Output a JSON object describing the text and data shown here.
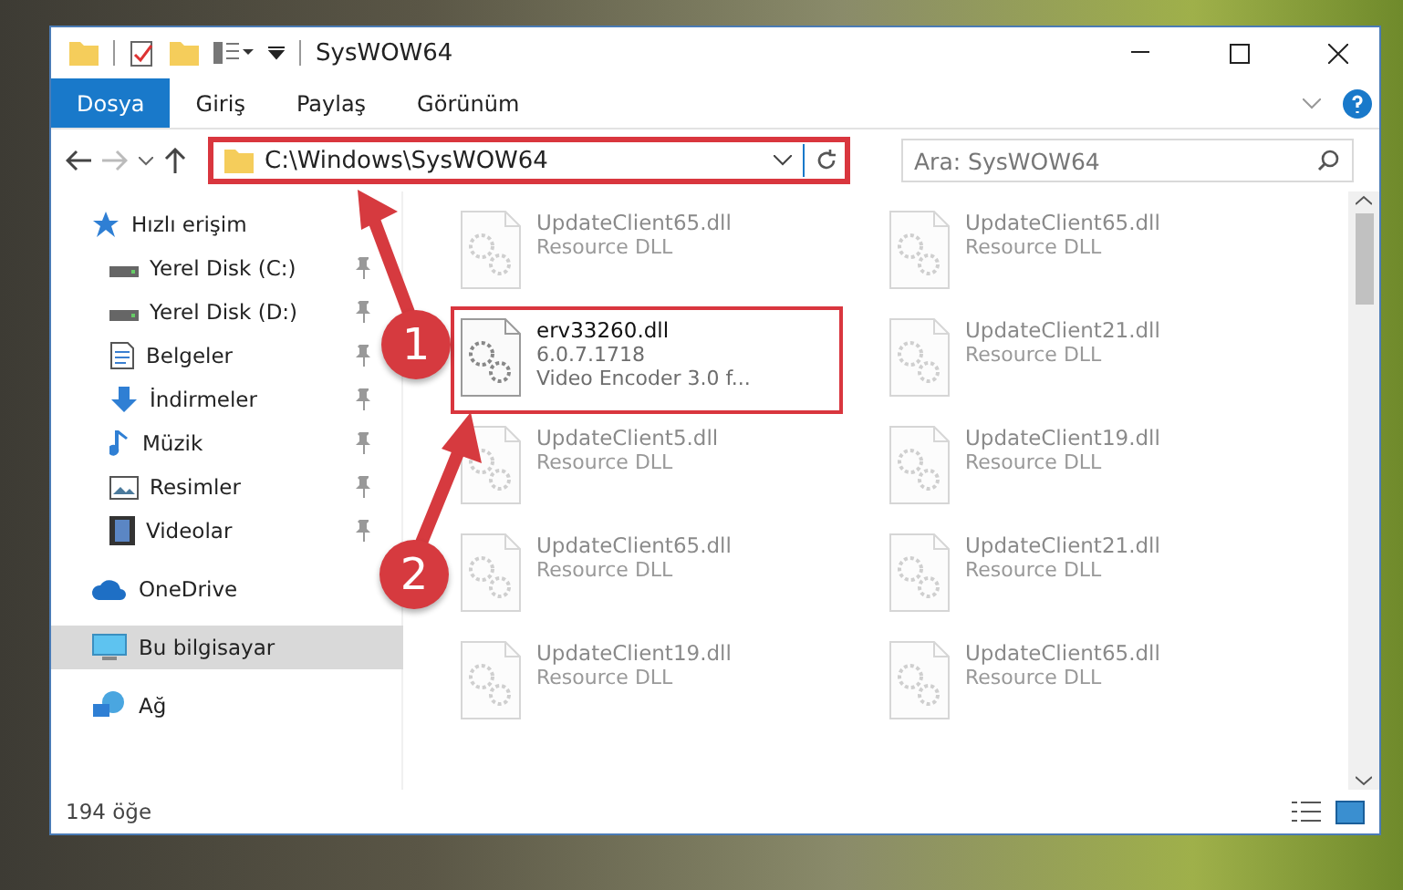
{
  "window": {
    "title": "SysWOW64"
  },
  "ribbon": {
    "tabs": [
      {
        "label": "Dosya",
        "selected": true
      },
      {
        "label": "Giriş",
        "selected": false
      },
      {
        "label": "Paylaş",
        "selected": false
      },
      {
        "label": "Görünüm",
        "selected": false
      }
    ]
  },
  "address": {
    "path": "C:\\Windows\\SysWOW64",
    "highlighted": true
  },
  "search": {
    "placeholder": "Ara: SysWOW64"
  },
  "sidebar": {
    "items": [
      {
        "label": "Hızlı erişim",
        "kind": "star",
        "selected": false,
        "children": [
          {
            "label": "Yerel Disk (C:)",
            "kind": "drive",
            "pinned": true
          },
          {
            "label": "Yerel Disk (D:)",
            "kind": "drive",
            "pinned": true
          },
          {
            "label": "Belgeler",
            "kind": "document",
            "pinned": true
          },
          {
            "label": "İndirmeler",
            "kind": "download",
            "pinned": true
          },
          {
            "label": "Müzik",
            "kind": "music",
            "pinned": true
          },
          {
            "label": "Resimler",
            "kind": "picture",
            "pinned": true
          },
          {
            "label": "Videolar",
            "kind": "video",
            "pinned": true
          }
        ]
      },
      {
        "label": "OneDrive",
        "kind": "cloud",
        "selected": false
      },
      {
        "label": "Bu bilgisayar",
        "kind": "computer",
        "selected": true
      },
      {
        "label": "Ağ",
        "kind": "network",
        "selected": false
      }
    ]
  },
  "files": [
    {
      "name": "UpdateClient65.dll",
      "line_2": "Resource DLL",
      "blurred": true,
      "highlighted": false
    },
    {
      "name": "UpdateClient65.dll",
      "line_2": "Resource DLL",
      "blurred": true,
      "highlighted": false
    },
    {
      "name": "erv33260.dll",
      "line_2": "6.0.7.1718",
      "line_3": "Video Encoder 3.0 f...",
      "blurred": false,
      "highlighted": true
    },
    {
      "name": "UpdateClient21.dll",
      "line_2": "Resource DLL",
      "blurred": true,
      "highlighted": false
    },
    {
      "name": "UpdateClient5.dll",
      "line_2": "Resource DLL",
      "blurred": true,
      "highlighted": false
    },
    {
      "name": "UpdateClient19.dll",
      "line_2": "Resource DLL",
      "blurred": true,
      "highlighted": false
    },
    {
      "name": "UpdateClient65.dll",
      "line_2": "Resource DLL",
      "blurred": true,
      "highlighted": false
    },
    {
      "name": "UpdateClient21.dll",
      "line_2": "Resource DLL",
      "blurred": true,
      "highlighted": false
    },
    {
      "name": "UpdateClient19.dll",
      "line_2": "Resource DLL",
      "blurred": true,
      "highlighted": false
    },
    {
      "name": "UpdateClient65.dll",
      "line_2": "Resource DLL",
      "blurred": true,
      "highlighted": false
    }
  ],
  "status_bar": {
    "count": "194 öğe"
  },
  "callouts": [
    {
      "number": "1"
    },
    {
      "number": "2"
    }
  ]
}
